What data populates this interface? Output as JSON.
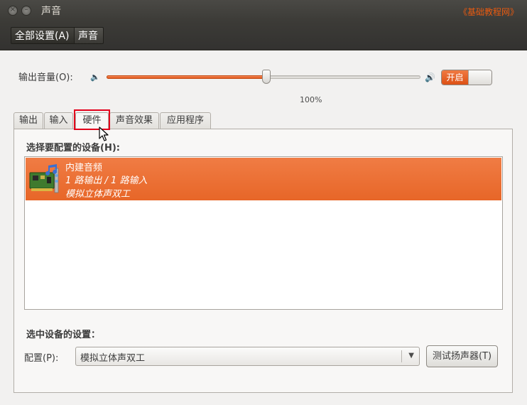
{
  "window": {
    "title": "声音",
    "watermark": "《基础教程网》"
  },
  "toolbar": {
    "all_settings": "全部设置(A)",
    "current": "声音"
  },
  "volume": {
    "label": "输出音量(O):",
    "percent_text": "100%",
    "level_fraction": 0.51,
    "switch_label": "开启"
  },
  "tabs": [
    {
      "label": "输出",
      "active": false
    },
    {
      "label": "输入",
      "active": false
    },
    {
      "label": "硬件",
      "active": true
    },
    {
      "label": "声音效果",
      "active": false
    },
    {
      "label": "应用程序",
      "active": false
    }
  ],
  "hardware": {
    "choose_title": "选择要配置的设备(H):",
    "devices": [
      {
        "name": "内建音频",
        "line2": "1 路输出 / 1 路输入",
        "line3": "模拟立体声双工",
        "selected": true
      }
    ],
    "settings_title": "选中设备的设置：",
    "profile_label": "配置(P):",
    "profile_value": "模拟立体声双工",
    "test_button": "测试扬声器(T)"
  },
  "colors": {
    "accent": "#e76628",
    "titlebar": "#3c3b37",
    "highlight_box": "#e3001b"
  },
  "icons": {
    "close": "close-icon",
    "minimize": "minimize-icon",
    "speaker_low": "speaker-low-icon",
    "speaker_high": "speaker-high-icon",
    "sound_card": "sound-card-icon",
    "combo_arrow": "chevron-down-icon",
    "pointer": "mouse-pointer-icon"
  }
}
